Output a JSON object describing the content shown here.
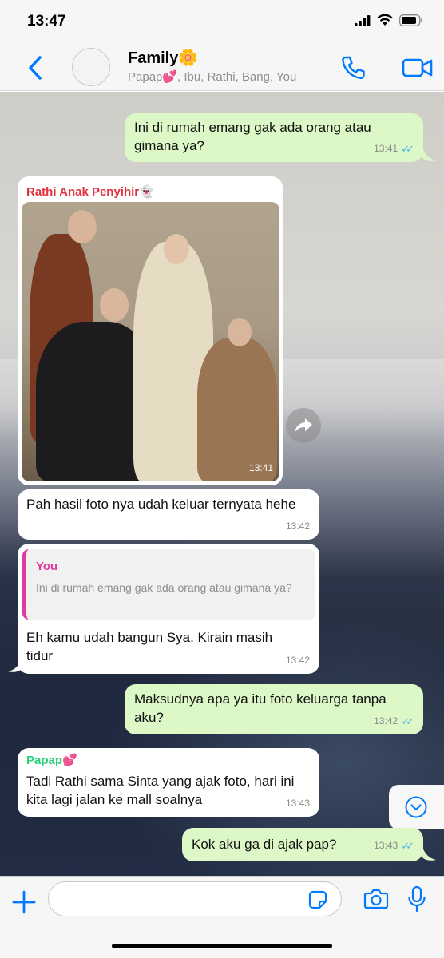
{
  "status_bar": {
    "time": "13:47"
  },
  "header": {
    "title": "Family🌼",
    "subtitle": "Papap💕, Ibu, Rathi, Bang, You"
  },
  "messages": [
    {
      "text": "Ini di rumah emang gak ada orang atau gimana ya?",
      "time": "13:41"
    },
    {
      "sender": "Rathi Anak Penyihir👻",
      "time": "13:41"
    },
    {
      "text": "Pah hasil foto nya udah keluar ternyata hehe",
      "time": "13:42"
    },
    {
      "quote_name": "You",
      "quote_text": "Ini di rumah emang gak ada orang atau gimana ya?",
      "text": "Eh kamu udah bangun Sya. Kirain masih tidur",
      "time": "13:42"
    },
    {
      "text": "Maksudnya apa ya itu foto keluarga tanpa aku?",
      "time": "13:42"
    },
    {
      "sender": "Papap💕",
      "text": "Tadi Rathi sama Sinta yang ajak foto, hari ini kita lagi jalan ke mall soalnya",
      "time": "13:43"
    },
    {
      "text": "Kok aku ga di ajak pap?",
      "time": "13:43"
    }
  ],
  "colors": {
    "accent": "#007aff",
    "outgoing_bubble": "#dcf8c6",
    "incoming_bubble": "#ffffff",
    "sender_rathi": "#e2313c",
    "sender_papap": "#2bd07a",
    "quote_accent": "#e03a9c",
    "read_ticks": "#4fb6ec"
  },
  "icons": [
    "back-chevron-icon",
    "phone-icon",
    "video-camera-icon",
    "forward-icon",
    "chevron-down-icon",
    "plus-icon",
    "sticker-icon",
    "camera-icon",
    "microphone-icon"
  ],
  "input": {
    "placeholder": "",
    "value": ""
  }
}
